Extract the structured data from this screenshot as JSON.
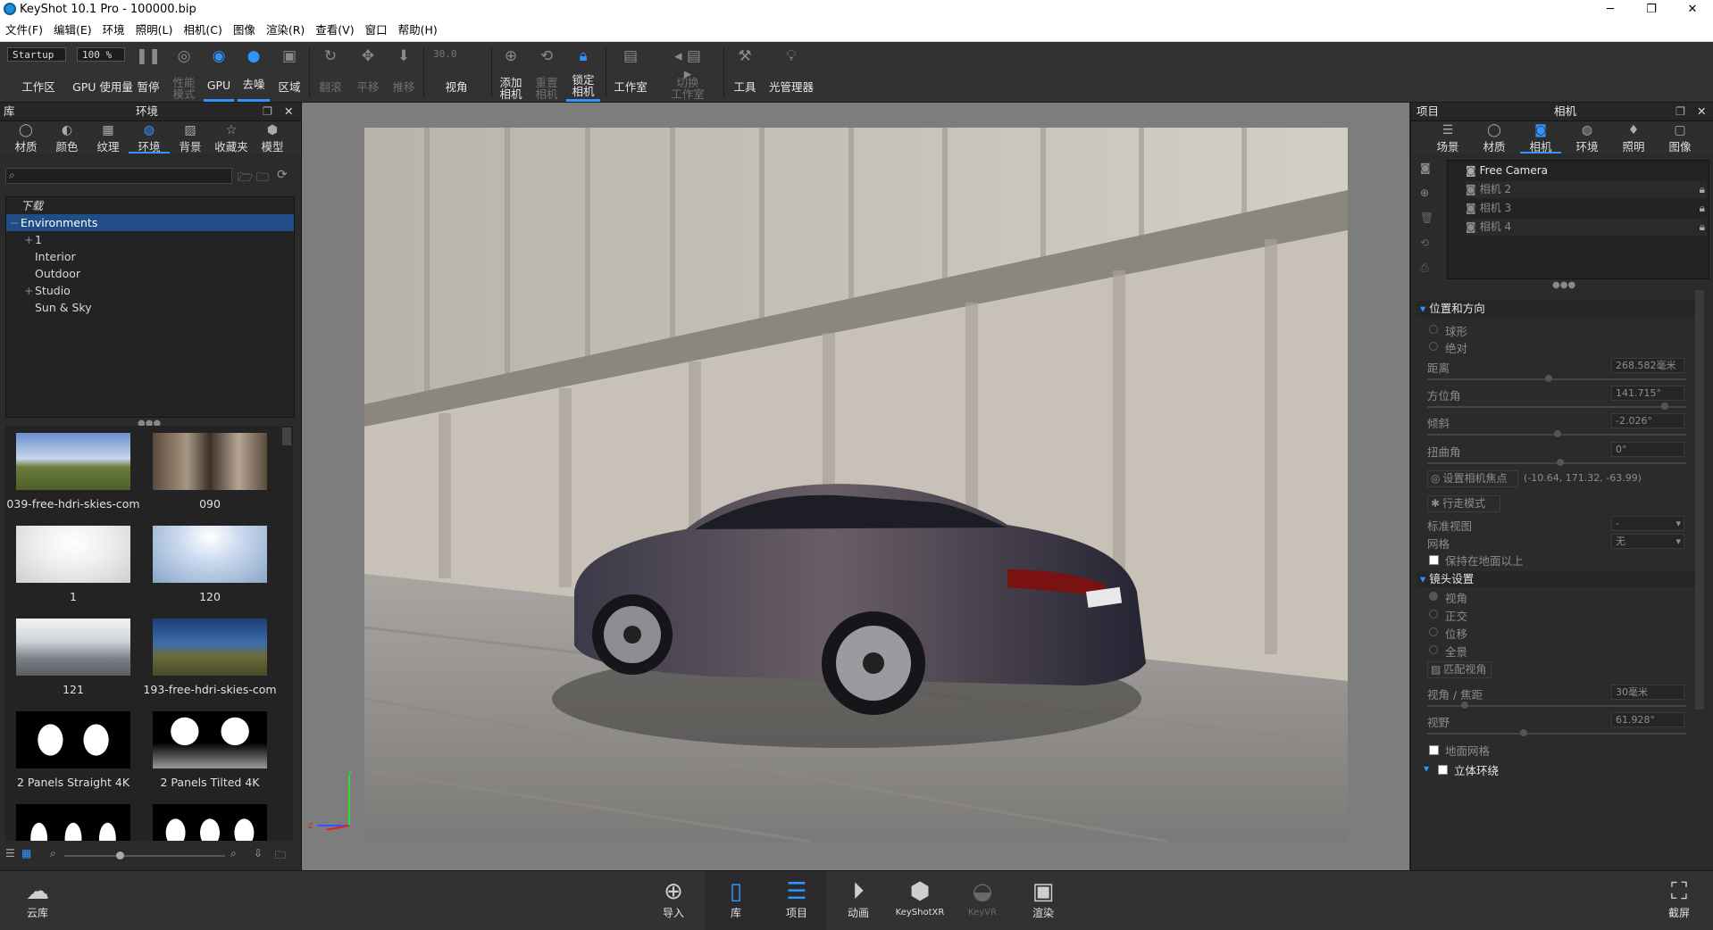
{
  "titlebar": {
    "title": "KeyShot 10.1 Pro  - 100000.bip",
    "minimize": "─",
    "restore": "❐",
    "close": "✕"
  },
  "menu": [
    "文件(F)",
    "编辑(E)",
    "环境",
    "照明(L)",
    "相机(C)",
    "图像",
    "渲染(R)",
    "查看(V)",
    "窗口",
    "帮助(H)"
  ],
  "toolbar": {
    "workspace_value": "Startup",
    "workspace_label": "工作区",
    "gpu_usage_value": "100 %",
    "gpu_usage_label": "GPU 使用量",
    "pause": "暂停",
    "perf_mode": "性能\n模式",
    "gpu": "GPU",
    "denoise": "去噪",
    "region": "区域",
    "tumble": "翻滚",
    "pan": "平移",
    "dolly": "推移",
    "fov_value": "30.0",
    "fov_label": "视角",
    "add_camera": "添加\n相机",
    "reset_camera": "重置\n相机",
    "lock_camera": "锁定\n相机",
    "studio": "工作室",
    "switch_studio": "切换\n工作室",
    "tools": "工具",
    "light_manager": "光管理器"
  },
  "library": {
    "title": "库",
    "panel_title": "环境",
    "tabs": [
      "材质",
      "颜色",
      "纹理",
      "环境",
      "背景",
      "收藏夹",
      "模型"
    ],
    "active_tab": "环境",
    "tree": [
      {
        "label": "下载",
        "indent": 0,
        "expander": ""
      },
      {
        "label": "Environments",
        "indent": 0,
        "expander": "−"
      },
      {
        "label": "1",
        "indent": 1,
        "expander": "+"
      },
      {
        "label": "Interior",
        "indent": 1,
        "expander": ""
      },
      {
        "label": "Outdoor",
        "indent": 1,
        "expander": ""
      },
      {
        "label": "Studio",
        "indent": 1,
        "expander": "+"
      },
      {
        "label": "Sun & Sky",
        "indent": 1,
        "expander": ""
      }
    ],
    "thumbnails": [
      "039-free-hdri-skies-com",
      "090",
      "1",
      "120",
      "121",
      "193-free-hdri-skies-com",
      "2 Panels Straight 4K",
      "2 Panels Tilted 4K"
    ]
  },
  "project": {
    "title": "项目",
    "panel_title": "相机",
    "tabs": [
      "场景",
      "材质",
      "相机",
      "环境",
      "照明",
      "图像"
    ],
    "active_tab": "相机",
    "cameras": [
      "Free Camera",
      "相机 2",
      "相机 3",
      "相机 4"
    ],
    "section_position": "位置和方向",
    "orbit": "球形",
    "absolute": "绝对",
    "distance_label": "距离",
    "distance_value": "268.582毫米",
    "azimuth_label": "方位角",
    "azimuth_value": "141.715°",
    "inclination_label": "倾斜",
    "inclination_value": "-2.026°",
    "twist_label": "扭曲角",
    "twist_value": "0°",
    "set_focus": "设置相机焦点",
    "focus_coords": "(-10.64, 171.32, -63.99)",
    "walk_mode": "行走模式",
    "standard_view_label": "标准视图",
    "standard_view_value": "-",
    "grid_label": "网格",
    "grid_value": "无",
    "keep_above_ground": "保持在地面以上",
    "section_lens": "镜头设置",
    "lens_perspective": "视角",
    "lens_ortho": "正交",
    "lens_shift": "位移",
    "lens_panorama": "全景",
    "match_perspective": "匹配视角",
    "fov_focal_label": "视角 / 焦距",
    "fov_focal_value": "30毫米",
    "fov_label": "视野",
    "fov_value": "61.928°",
    "ground_grid": "地面网格",
    "stereo": "立体环绕"
  },
  "dock": {
    "cloud": "云库",
    "import": "导入",
    "library": "库",
    "project": "项目",
    "animation": "动画",
    "keyshotxr": "KeyShotXR",
    "keyvr": "KeyVR",
    "render": "渲染",
    "screenshot": "截屏"
  },
  "colors": {
    "accent": "#2e95ff",
    "selection": "#214d86",
    "panel": "#2b2b2b"
  }
}
